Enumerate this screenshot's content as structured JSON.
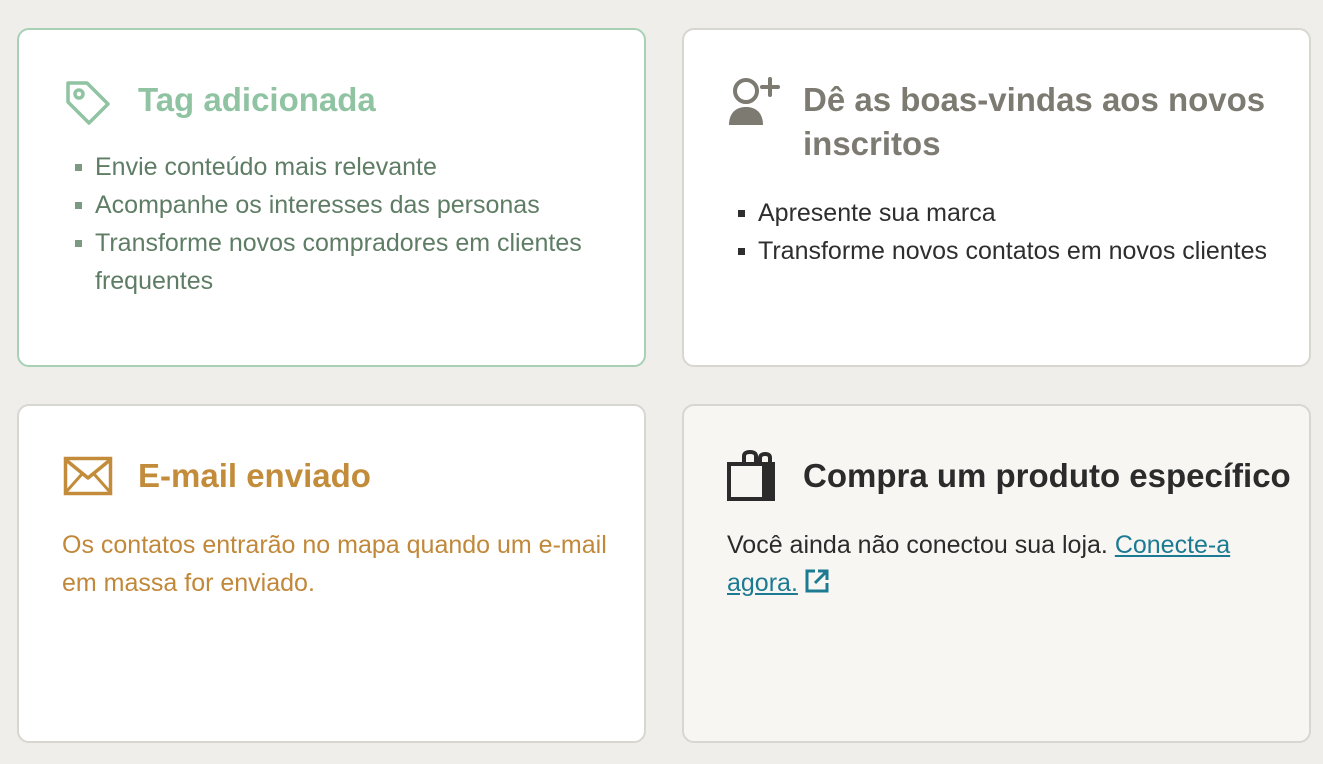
{
  "cards": {
    "tag": {
      "icon": "tag-icon",
      "title": "Tag adicionada",
      "bullets": [
        "Envie conteúdo mais relevante",
        "Acompanhe os interesses das personas",
        "Transforme novos compradores em clientes frequentes"
      ],
      "accent": "#8fc3a2"
    },
    "welcome": {
      "icon": "add-user-icon",
      "title": "Dê as boas-vindas aos novos inscritos",
      "bullets": [
        "Apresente sua marca",
        "Transforme novos contatos em novos clientes"
      ]
    },
    "email": {
      "icon": "envelope-icon",
      "title": "E-mail enviado",
      "description": "Os contatos entrarão no mapa quando um e-mail em massa for enviado.",
      "accent": "#c38c3a"
    },
    "purchase": {
      "icon": "shopping-bag-icon",
      "title": "Compra um produto específico",
      "description": "Você ainda não conectou sua loja.",
      "link_label": "Conecte-a agora.",
      "link_icon": "external-link-icon",
      "link_color": "#1d7a93"
    }
  }
}
